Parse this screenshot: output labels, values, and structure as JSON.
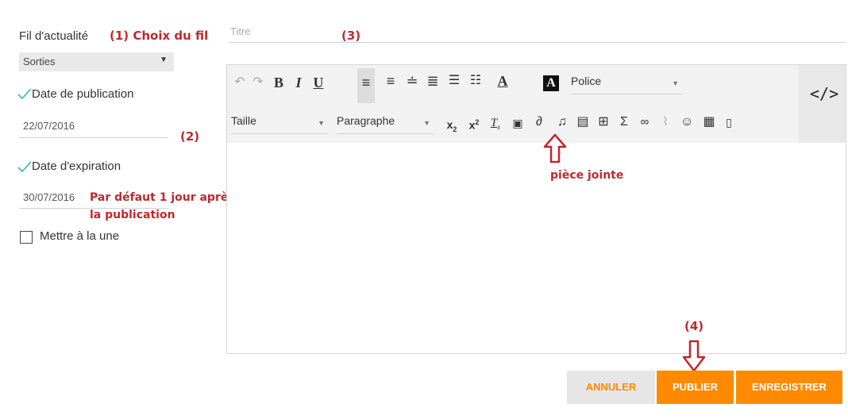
{
  "form": {
    "feed_label": "Fil d'actualité",
    "feed_select_value": "Sorties",
    "publication_label": "Date de publication",
    "publication_date": "22/07/2016",
    "expiration_label": "Date d'expiration",
    "expiration_date": "30/07/2016",
    "headline_label": "Mettre à la une",
    "title_placeholder": "Titre"
  },
  "toolbar": {
    "font_label": "Police",
    "size_label": "Taille",
    "format_label": "Paragraphe"
  },
  "buttons": {
    "cancel": "ANNULER",
    "publish": "PUBLIER",
    "save": "ENREGISTRER"
  },
  "annotations": {
    "a1": "(1) Choix du fil",
    "a2": "(2)",
    "a2_text_line1": "Par défaut 1 jour après",
    "a2_text_line2": "la publication",
    "a3": "(3)",
    "attachment": "pièce jointe",
    "a4": "(4)"
  },
  "colors": {
    "accent": "#ff8a00",
    "annotation": "#c0282d",
    "check": "#35b8a8"
  },
  "icons": [
    "undo-icon",
    "redo-icon",
    "bold-icon",
    "italic-icon",
    "underline-icon",
    "align-left-icon",
    "align-center-icon",
    "align-justify-left-icon",
    "align-justify-icon",
    "bulleted-list-icon",
    "numbered-list-icon",
    "text-color-icon",
    "background-color-icon",
    "subscript-icon",
    "superscript-icon",
    "clear-format-icon",
    "image-icon",
    "attachment-icon",
    "audio-icon",
    "video-icon",
    "table-grid-icon",
    "sigma-icon",
    "link-icon",
    "unlink-icon",
    "smiley-icon",
    "table-icon",
    "document-icon",
    "source-code-icon"
  ]
}
